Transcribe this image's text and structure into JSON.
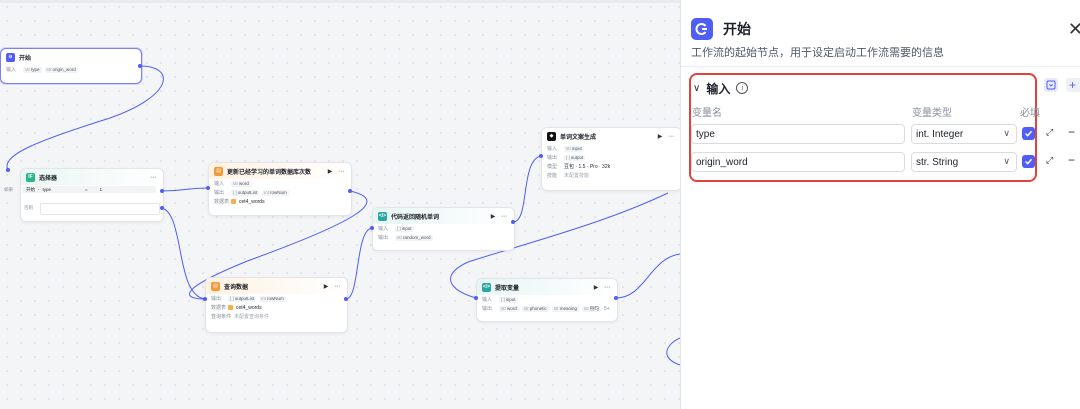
{
  "nodes": {
    "start": {
      "title": "开始",
      "io_label": "输入",
      "params": [
        {
          "type": "str",
          "name": "type"
        },
        {
          "type": "str",
          "name": "origin_word"
        }
      ]
    },
    "selector": {
      "title": "选择器",
      "if_label": "如果",
      "node_ref": "开始",
      "sep": "-",
      "var": "type",
      "op": "=",
      "value": "1",
      "else_label": "否则"
    },
    "update_db": {
      "title": "更新已经学习的单词数据库次数",
      "input_label": "输入",
      "input": {
        "type": "str",
        "name": "word"
      },
      "output_label": "输出",
      "outputs": [
        {
          "type": "[ ]",
          "name": "outputList"
        },
        {
          "type": "int",
          "name": "rowNum"
        }
      ],
      "db_label": "数据表",
      "db": "cet4_words"
    },
    "query_db": {
      "title": "查询数据",
      "output_label": "输出",
      "outputs": [
        {
          "type": "[ ]",
          "name": "outputList"
        },
        {
          "type": "int",
          "name": "rowNum"
        }
      ],
      "db_label": "数据表",
      "db": "cet4_words",
      "cond_label": "查询条件",
      "cond": "未配置查询条件"
    },
    "code_random": {
      "title": "代码返回随机单词",
      "input_label": "输入",
      "input": {
        "type": "[ ]",
        "name": "input"
      },
      "output_label": "输出",
      "output": {
        "type": "str",
        "name": "random_word"
      }
    },
    "llm": {
      "title": "单词文案生成",
      "input_label": "输入",
      "input": {
        "type": "str",
        "name": "input"
      },
      "output_label": "输出",
      "output": {
        "type": "[ ]",
        "name": "output"
      },
      "model_label": "模型",
      "model": "豆包 · 1.5 · Pro · 32k",
      "skill_label": "技能",
      "skill": "未配置技能"
    },
    "extract": {
      "title": "提取变量",
      "input_label": "输入",
      "input": {
        "type": "[ ]",
        "name": "input"
      },
      "output_label": "输出",
      "outputs": [
        {
          "type": "str",
          "name": "word"
        },
        {
          "type": "str",
          "name": "phonetic"
        },
        {
          "type": "str",
          "name": "meaning"
        },
        {
          "type": "str",
          "name": "例句"
        }
      ],
      "more": "5+"
    }
  },
  "panel": {
    "title": "开始",
    "description": "工作流的起始节点，用于设定启动工作流需要的信息",
    "section_title": "输入",
    "col_name": "变量名",
    "col_type": "变量类型",
    "col_required": "必填",
    "variables": [
      {
        "name": "type",
        "type": "int. Integer",
        "required": true
      },
      {
        "name": "origin_word",
        "type": "str. String",
        "required": true
      }
    ],
    "close_symbol": "✕",
    "add_symbol": "+"
  },
  "colors": {
    "accent": "#4e5ef6",
    "highlight": "#e0433a",
    "edge": "#4f5ef0"
  }
}
